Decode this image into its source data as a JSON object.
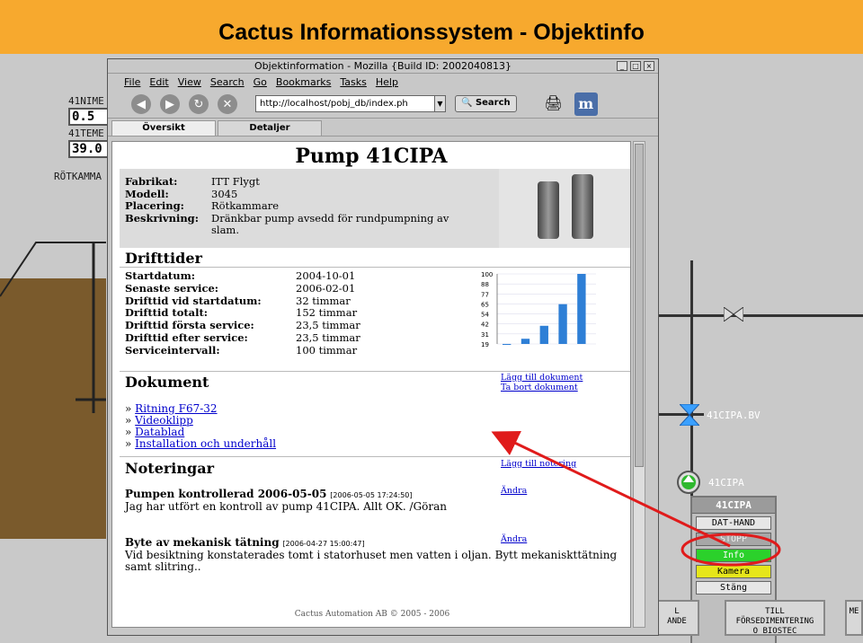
{
  "slide": {
    "title": "Cactus Informationssystem - Objektinfo"
  },
  "scada": {
    "tags": [
      {
        "label": "41NIME",
        "value": "0.5"
      },
      {
        "label": "41TEME",
        "value": "39.0"
      }
    ],
    "tank_label": "RÖTKAMMA",
    "valve_label": "41CIPA.BV",
    "pump_label": "41CIPA",
    "popup": {
      "title": "41CIPA",
      "buttons": [
        "DAT-HAND",
        "STOPP",
        "Info",
        "Kamera",
        "Stäng"
      ]
    },
    "bottom_buttons": [
      {
        "line1": "L",
        "line2": "ANDE"
      },
      {
        "line1": "TILL",
        "line2": "FÖRSEDIMENTERING",
        "line3": "O BIOSTEC"
      },
      {
        "line1": "ME",
        "line2": ""
      }
    ]
  },
  "browser": {
    "window_title": "Objektinformation - Mozilla {Build ID: 2002040813}",
    "menu": [
      "File",
      "Edit",
      "View",
      "Search",
      "Go",
      "Bookmarks",
      "Tasks",
      "Help"
    ],
    "url": "http://localhost/pobj_db/index.ph",
    "search_label": "Search",
    "tabs": [
      "Översikt",
      "Detaljer"
    ]
  },
  "page": {
    "title": "Pump 41CIPA",
    "info": [
      {
        "k": "Fabrikat:",
        "v": "ITT Flygt"
      },
      {
        "k": "Modell:",
        "v": "3045"
      },
      {
        "k": "Placering:",
        "v": "Rötkammare"
      },
      {
        "k": "Beskrivning:",
        "v": "Dränkbar pump avsedd för rundpumpning av slam."
      }
    ],
    "drifttider_heading": "Drifttider",
    "drifttider": [
      {
        "k": "Startdatum:",
        "v": "2004-10-01"
      },
      {
        "k": "Senaste service:",
        "v": "2006-02-01"
      },
      {
        "k": "Drifttid vid startdatum:",
        "v": "32 timmar"
      },
      {
        "k": "Drifttid totalt:",
        "v": "152 timmar"
      },
      {
        "k": "Drifttid första service:",
        "v": "23,5 timmar"
      },
      {
        "k": "Drifttid efter service:",
        "v": "23,5 timmar"
      },
      {
        "k": "Serviceintervall:",
        "v": "100 timmar"
      }
    ],
    "dokument_heading": "Dokument",
    "dokument_links": [
      "Ritning F67-32",
      "Videoklipp",
      "Datablad",
      "Installation och underhåll"
    ],
    "dokument_actions": [
      "Lägg till dokument",
      "Ta bort dokument"
    ],
    "noteringar_heading": "Noteringar",
    "add_note": "Lägg till notering",
    "notes": [
      {
        "title": "Pumpen kontrollerad 2006-05-05",
        "stamp": "[2006-05-05 17:24:50]",
        "text": "Jag har utfört en kontroll av pump 41CIPA. Allt OK. /Göran",
        "edit": "Ändra"
      },
      {
        "title": "Byte av mekanisk tätning",
        "stamp": "[2006-04-27 15:00:47]",
        "text": "Vid besiktning konstaterades tomt i statorhuset men vatten i oljan. Bytt mekaniskttätning samt slitring..",
        "edit": "Ändra"
      }
    ],
    "footer": "Cactus Automation AB © 2005 - 2006"
  },
  "chart_data": {
    "type": "bar",
    "ylim": [
      19,
      100
    ],
    "y_ticks": [
      "100",
      "88",
      "77",
      "65",
      "54",
      "42",
      "31",
      "19"
    ],
    "values": [
      19,
      25,
      40,
      65,
      100
    ],
    "color": "#2e7fd6"
  }
}
